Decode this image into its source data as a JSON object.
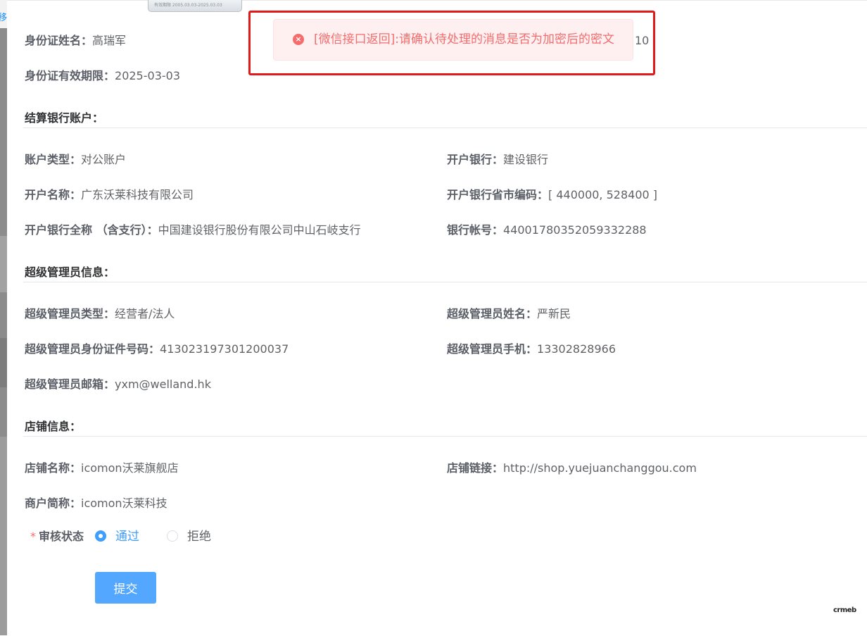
{
  "sidebar_fragment": "移",
  "id_card": {
    "name_label": "身份证姓名：",
    "name_value": "高瑞军",
    "expiry_label": "身份证有效期限：",
    "expiry_value": "2025-03-03",
    "thumb_text": "有效期限 2005.03.03-2025.03.03",
    "partial_number_tail": "10"
  },
  "settlement": {
    "title": "结算银行账户：",
    "fields": [
      {
        "label": "账户类型：",
        "value": "对公账户"
      },
      {
        "label": "开户银行：",
        "value": "建设银行"
      },
      {
        "label": "开户名称：",
        "value": "广东沃莱科技有限公司"
      },
      {
        "label": "开户银行省市编码：",
        "value": "[ 440000, 528400 ]"
      },
      {
        "label": "开户银行全称 （含支行）：",
        "value": "中国建设银行股份有限公司中山石岐支行"
      },
      {
        "label": "银行帐号：",
        "value": "44001780352059332288"
      }
    ]
  },
  "admin": {
    "title": "超级管理员信息：",
    "fields": [
      {
        "label": "超级管理员类型：",
        "value": "经营者/法人"
      },
      {
        "label": "超级管理员姓名：",
        "value": "严新民"
      },
      {
        "label": "超级管理员身份证件号码：",
        "value": "413023197301200037"
      },
      {
        "label": "超级管理员手机：",
        "value": "13302828966"
      },
      {
        "label": "超级管理员邮箱：",
        "value": "yxm@welland.hk"
      }
    ]
  },
  "store": {
    "title": "店铺信息：",
    "fields": [
      {
        "label": "店铺名称：",
        "value": "icomon沃莱旗舰店"
      },
      {
        "label": "店铺链接：",
        "value": "http://shop.yuejuanchanggou.com"
      },
      {
        "label": "商户简称：",
        "value": "icomon沃莱科技"
      }
    ]
  },
  "review": {
    "required_mark": "*",
    "label": "审核状态",
    "options": [
      "通过",
      "拒绝"
    ],
    "selected": "通过"
  },
  "submit_label": "提交",
  "toast": {
    "icon_glyph": "×",
    "message": "[微信接口返回]:请确认待处理的消息是否为加密后的密文"
  },
  "logo_text": "crmeb",
  "colors": {
    "primary": "#409eff",
    "button": "#54a7ff",
    "error": "#f56c6c",
    "highlight_border": "#e01919"
  }
}
